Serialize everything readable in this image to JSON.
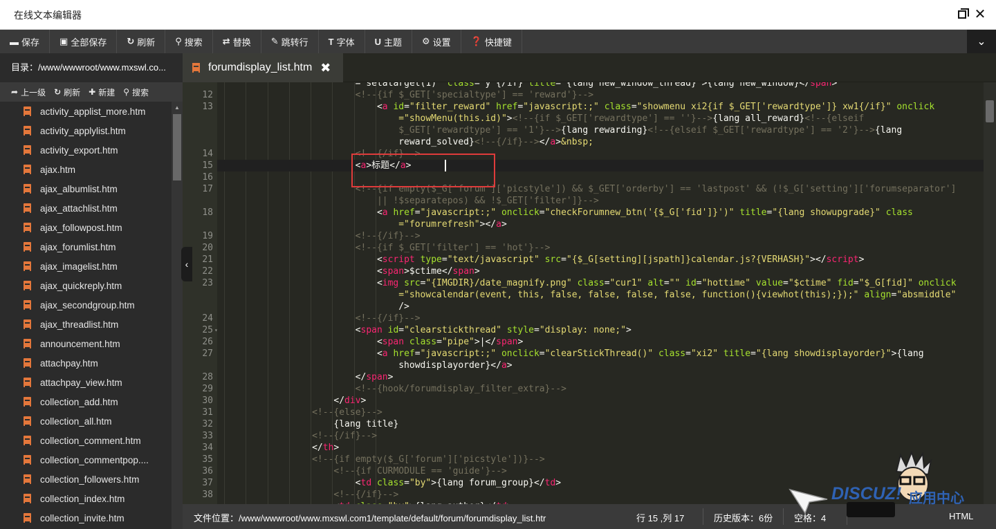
{
  "window": {
    "title": "在线文本编辑器"
  },
  "toolbar": [
    {
      "icon": "save-icon",
      "glyph": "▬",
      "label": "保存"
    },
    {
      "icon": "save-all-icon",
      "glyph": "▣",
      "label": "全部保存"
    },
    {
      "icon": "refresh-icon",
      "glyph": "↻",
      "label": "刷新"
    },
    {
      "icon": "search-icon",
      "glyph": "⚲",
      "label": "搜索"
    },
    {
      "icon": "replace-icon",
      "glyph": "⇄",
      "label": "替换"
    },
    {
      "icon": "goto-line-icon",
      "glyph": "✎",
      "label": "跳转行"
    },
    {
      "icon": "font-icon",
      "glyph": "T",
      "label": "字体"
    },
    {
      "icon": "theme-icon",
      "glyph": "U",
      "label": "主题"
    },
    {
      "icon": "gear-icon",
      "glyph": "⚙",
      "label": "设置"
    },
    {
      "icon": "help-icon",
      "glyph": "❓",
      "label": "快捷键"
    }
  ],
  "sidebar": {
    "path": "目录：/www/wwwroot/www.mxswl.co...",
    "actions": [
      {
        "icon": "arrow-up-icon",
        "glyph": "➦",
        "label": "上一级"
      },
      {
        "icon": "refresh-icon",
        "glyph": "↻",
        "label": "刷新"
      },
      {
        "icon": "plus-icon",
        "glyph": "✚",
        "label": "新建"
      },
      {
        "icon": "search-icon",
        "glyph": "⚲",
        "label": "搜索"
      }
    ],
    "files": [
      "activity_applist_more.htm",
      "activity_applylist.htm",
      "activity_export.htm",
      "ajax.htm",
      "ajax_albumlist.htm",
      "ajax_attachlist.htm",
      "ajax_followpost.htm",
      "ajax_forumlist.htm",
      "ajax_imagelist.htm",
      "ajax_quickreply.htm",
      "ajax_secondgroup.htm",
      "ajax_threadlist.htm",
      "announcement.htm",
      "attachpay.htm",
      "attachpay_view.htm",
      "collection_add.htm",
      "collection_all.htm",
      "collection_comment.htm",
      "collection_commentpop....",
      "collection_followers.htm",
      "collection_index.htm",
      "collection_invite.htm"
    ]
  },
  "tab": {
    "filename": "forumdisplay_list.htm",
    "close": "✖"
  },
  "editor": {
    "lines": [
      {
        "n": "",
        "indent": 6,
        "parts": [
          [
            "p",
            "=\"setatarget(1)\" "
          ],
          [
            "a",
            "class"
          ],
          [
            "p",
            "=\"y\"{/if} "
          ],
          [
            "a",
            "title"
          ],
          [
            "p",
            "=\"{lang new_window_thread}\">{lang new_window}</"
          ],
          [
            "t",
            "span"
          ],
          [
            "p",
            ">"
          ]
        ]
      },
      {
        "n": "12",
        "indent": 6,
        "parts": [
          [
            "c",
            "<!--{if $_GET['specialtype'] == 'reward'}-->"
          ]
        ]
      },
      {
        "n": "13",
        "indent": 7,
        "parts": [
          [
            "p",
            "<"
          ],
          [
            "t",
            "a"
          ],
          [
            "p",
            " "
          ],
          [
            "a",
            "id"
          ],
          [
            "p",
            "="
          ],
          [
            "s",
            "\"filter_reward\""
          ],
          [
            "p",
            " "
          ],
          [
            "a",
            "href"
          ],
          [
            "p",
            "="
          ],
          [
            "s",
            "\"javascript:;\""
          ],
          [
            "p",
            " "
          ],
          [
            "a",
            "class"
          ],
          [
            "p",
            "="
          ],
          [
            "s",
            "\"showmenu xi2{if $_GET['rewardtype']} xw1{/if}\""
          ],
          [
            "p",
            " "
          ],
          [
            "a",
            "onclick"
          ]
        ]
      },
      {
        "n": "",
        "indent": 8,
        "parts": [
          [
            "s",
            "=\"showMenu(this.id)\""
          ],
          [
            "p",
            ">"
          ],
          [
            "c",
            "<!--{if $_GET['rewardtype'] == ''}-->"
          ],
          [
            "p",
            "{lang all_reward}"
          ],
          [
            "c",
            "<!--{elseif"
          ]
        ]
      },
      {
        "n": "",
        "indent": 8,
        "parts": [
          [
            "c",
            "$_GET['rewardtype'] == '1'}-->"
          ],
          [
            "p",
            "{lang rewarding}"
          ],
          [
            "c",
            "<!--{elseif $_GET['rewardtype'] == '2'}-->"
          ],
          [
            "p",
            "{lang"
          ]
        ]
      },
      {
        "n": "",
        "indent": 8,
        "parts": [
          [
            "p",
            "reward_solved}"
          ],
          [
            "c",
            "<!--{/if}-->"
          ],
          [
            "p",
            "</"
          ],
          [
            "t",
            "a"
          ],
          [
            "p",
            ">"
          ],
          [
            "s",
            "&nbsp;"
          ]
        ]
      },
      {
        "n": "14",
        "indent": 6,
        "parts": [
          [
            "c",
            "<!--{/if}-->"
          ]
        ]
      },
      {
        "n": "15",
        "indent": 6,
        "parts": [
          [
            "p",
            "<"
          ],
          [
            "t",
            "a"
          ],
          [
            "p",
            ">标题</"
          ],
          [
            "t",
            "a"
          ],
          [
            "p",
            ">"
          ]
        ]
      },
      {
        "n": "16",
        "indent": 6,
        "parts": []
      },
      {
        "n": "17",
        "indent": 6,
        "parts": [
          [
            "c",
            "<!--{if empty($_G['forum']['picstyle']) && $_GET['orderby'] == 'lastpost' && (!$_G['setting']['forumseparator']"
          ]
        ]
      },
      {
        "n": "",
        "indent": 7,
        "parts": [
          [
            "c",
            "|| !$separatepos) && !$_GET['filter']}-->"
          ]
        ]
      },
      {
        "n": "18",
        "indent": 7,
        "parts": [
          [
            "p",
            "<"
          ],
          [
            "t",
            "a"
          ],
          [
            "p",
            " "
          ],
          [
            "a",
            "href"
          ],
          [
            "p",
            "="
          ],
          [
            "s",
            "\"javascript:;\""
          ],
          [
            "p",
            " "
          ],
          [
            "a",
            "onclick"
          ],
          [
            "p",
            "="
          ],
          [
            "s",
            "\"checkForumnew_btn('{$_G['fid']}')\""
          ],
          [
            "p",
            " "
          ],
          [
            "a",
            "title"
          ],
          [
            "p",
            "="
          ],
          [
            "s",
            "\"{lang showupgrade}\""
          ],
          [
            "p",
            " "
          ],
          [
            "a",
            "class"
          ]
        ]
      },
      {
        "n": "",
        "indent": 8,
        "parts": [
          [
            "s",
            "=\"forumrefresh\""
          ],
          [
            "p",
            "></"
          ],
          [
            "t",
            "a"
          ],
          [
            "p",
            ">"
          ]
        ]
      },
      {
        "n": "19",
        "indent": 6,
        "parts": [
          [
            "c",
            "<!--{/if}-->"
          ]
        ]
      },
      {
        "n": "20",
        "indent": 6,
        "parts": [
          [
            "c",
            "<!--{if $_GET['filter'] == 'hot'}-->"
          ]
        ]
      },
      {
        "n": "21",
        "indent": 7,
        "parts": [
          [
            "p",
            "<"
          ],
          [
            "t",
            "script"
          ],
          [
            "p",
            " "
          ],
          [
            "a",
            "type"
          ],
          [
            "p",
            "="
          ],
          [
            "s",
            "\"text/javascript\""
          ],
          [
            "p",
            " "
          ],
          [
            "a",
            "src"
          ],
          [
            "p",
            "="
          ],
          [
            "s",
            "\"{$_G[setting][jspath]}calendar.js?{VERHASH}\""
          ],
          [
            "p",
            "></"
          ],
          [
            "t",
            "script"
          ],
          [
            "p",
            ">"
          ]
        ]
      },
      {
        "n": "22",
        "indent": 7,
        "parts": [
          [
            "p",
            "<"
          ],
          [
            "t",
            "span"
          ],
          [
            "p",
            ">$ctime</"
          ],
          [
            "t",
            "span"
          ],
          [
            "p",
            ">"
          ]
        ]
      },
      {
        "n": "23",
        "indent": 7,
        "parts": [
          [
            "p",
            "<"
          ],
          [
            "t",
            "img"
          ],
          [
            "p",
            " "
          ],
          [
            "a",
            "src"
          ],
          [
            "p",
            "="
          ],
          [
            "s",
            "\"{IMGDIR}/date_magnify.png\""
          ],
          [
            "p",
            " "
          ],
          [
            "a",
            "class"
          ],
          [
            "p",
            "="
          ],
          [
            "s",
            "\"cur1\""
          ],
          [
            "p",
            " "
          ],
          [
            "a",
            "alt"
          ],
          [
            "p",
            "="
          ],
          [
            "s",
            "\"\""
          ],
          [
            "p",
            " "
          ],
          [
            "a",
            "id"
          ],
          [
            "p",
            "="
          ],
          [
            "s",
            "\"hottime\""
          ],
          [
            "p",
            " "
          ],
          [
            "a",
            "value"
          ],
          [
            "p",
            "="
          ],
          [
            "s",
            "\"$ctime\""
          ],
          [
            "p",
            " "
          ],
          [
            "a",
            "fid"
          ],
          [
            "p",
            "="
          ],
          [
            "s",
            "\"$_G[fid]\""
          ],
          [
            "p",
            " "
          ],
          [
            "a",
            "onclick"
          ]
        ]
      },
      {
        "n": "",
        "indent": 8,
        "parts": [
          [
            "s",
            "=\"showcalendar(event, this, false, false, false, false, function(){viewhot(this);});\""
          ],
          [
            "p",
            " "
          ],
          [
            "a",
            "align"
          ],
          [
            "p",
            "="
          ],
          [
            "s",
            "\"absmiddle\""
          ]
        ]
      },
      {
        "n": "",
        "indent": 8,
        "parts": [
          [
            "p",
            "/>"
          ]
        ]
      },
      {
        "n": "24",
        "indent": 6,
        "parts": [
          [
            "c",
            "<!--{/if}-->"
          ]
        ]
      },
      {
        "n": "25",
        "indent": 6,
        "fold": true,
        "parts": [
          [
            "p",
            "<"
          ],
          [
            "t",
            "span"
          ],
          [
            "p",
            " "
          ],
          [
            "a",
            "id"
          ],
          [
            "p",
            "="
          ],
          [
            "s",
            "\"clearstickthread\""
          ],
          [
            "p",
            " "
          ],
          [
            "a",
            "style"
          ],
          [
            "p",
            "="
          ],
          [
            "s",
            "\"display: none;\""
          ],
          [
            "p",
            ">"
          ]
        ]
      },
      {
        "n": "26",
        "indent": 7,
        "parts": [
          [
            "p",
            "<"
          ],
          [
            "t",
            "span"
          ],
          [
            "p",
            " "
          ],
          [
            "a",
            "class"
          ],
          [
            "p",
            "="
          ],
          [
            "s",
            "\"pipe\""
          ],
          [
            "p",
            ">|</"
          ],
          [
            "t",
            "span"
          ],
          [
            "p",
            ">"
          ]
        ]
      },
      {
        "n": "27",
        "indent": 7,
        "parts": [
          [
            "p",
            "<"
          ],
          [
            "t",
            "a"
          ],
          [
            "p",
            " "
          ],
          [
            "a",
            "href"
          ],
          [
            "p",
            "="
          ],
          [
            "s",
            "\"javascript:;\""
          ],
          [
            "p",
            " "
          ],
          [
            "a",
            "onclick"
          ],
          [
            "p",
            "="
          ],
          [
            "s",
            "\"clearStickThread()\""
          ],
          [
            "p",
            " "
          ],
          [
            "a",
            "class"
          ],
          [
            "p",
            "="
          ],
          [
            "s",
            "\"xi2\""
          ],
          [
            "p",
            " "
          ],
          [
            "a",
            "title"
          ],
          [
            "p",
            "="
          ],
          [
            "s",
            "\"{lang showdisplayorder}\""
          ],
          [
            "p",
            ">{lang"
          ]
        ]
      },
      {
        "n": "",
        "indent": 8,
        "parts": [
          [
            "p",
            "showdisplayorder}</"
          ],
          [
            "t",
            "a"
          ],
          [
            "p",
            ">"
          ]
        ]
      },
      {
        "n": "28",
        "indent": 6,
        "parts": [
          [
            "p",
            "</"
          ],
          [
            "t",
            "span"
          ],
          [
            "p",
            ">"
          ]
        ]
      },
      {
        "n": "29",
        "indent": 6,
        "parts": [
          [
            "c",
            "<!--{hook/forumdisplay_filter_extra}-->"
          ]
        ]
      },
      {
        "n": "30",
        "indent": 5,
        "parts": [
          [
            "p",
            "</"
          ],
          [
            "t",
            "div"
          ],
          [
            "p",
            ">"
          ]
        ]
      },
      {
        "n": "31",
        "indent": 4,
        "parts": [
          [
            "c",
            "<!--{else}-->"
          ]
        ]
      },
      {
        "n": "32",
        "indent": 5,
        "parts": [
          [
            "p",
            "{lang title}"
          ]
        ]
      },
      {
        "n": "33",
        "indent": 4,
        "parts": [
          [
            "c",
            "<!--{/if}-->"
          ]
        ]
      },
      {
        "n": "34",
        "indent": 4,
        "parts": [
          [
            "p",
            "</"
          ],
          [
            "t",
            "th"
          ],
          [
            "p",
            ">"
          ]
        ]
      },
      {
        "n": "35",
        "indent": 4,
        "parts": [
          [
            "c",
            "<!--{if empty($_G['forum']['picstyle'])}-->"
          ]
        ]
      },
      {
        "n": "36",
        "indent": 5,
        "parts": [
          [
            "c",
            "<!--{if CURMODULE == 'guide'}-->"
          ]
        ]
      },
      {
        "n": "37",
        "indent": 6,
        "parts": [
          [
            "p",
            "<"
          ],
          [
            "t",
            "td"
          ],
          [
            "p",
            " "
          ],
          [
            "a",
            "class"
          ],
          [
            "p",
            "="
          ],
          [
            "s",
            "\"by\""
          ],
          [
            "p",
            ">{lang forum_group}</"
          ],
          [
            "t",
            "td"
          ],
          [
            "p",
            ">"
          ]
        ]
      },
      {
        "n": "38",
        "indent": 5,
        "parts": [
          [
            "c",
            "<!--{/if}-->"
          ]
        ]
      },
      {
        "n": "",
        "indent": 5,
        "parts": [
          [
            "p",
            "<"
          ],
          [
            "t",
            "td"
          ],
          [
            "p",
            " "
          ],
          [
            "a",
            "class"
          ],
          [
            "p",
            "="
          ],
          [
            "s",
            "\"by\""
          ],
          [
            "p",
            ">{lang author}</"
          ],
          [
            "t",
            "td"
          ],
          [
            "p",
            ">"
          ]
        ]
      }
    ]
  },
  "status": {
    "file_location": "文件位置：/www/wwwroot/www.mxswl.com1/template/default/forum/forumdisplay_list.htr",
    "cursor_pos": "行 15 ,列 17",
    "history": "历史版本：6份",
    "indent": "空格：4",
    "mode": "HTML"
  },
  "watermark": {
    "brand": "DISCUZ!",
    "app": "应用中心"
  }
}
